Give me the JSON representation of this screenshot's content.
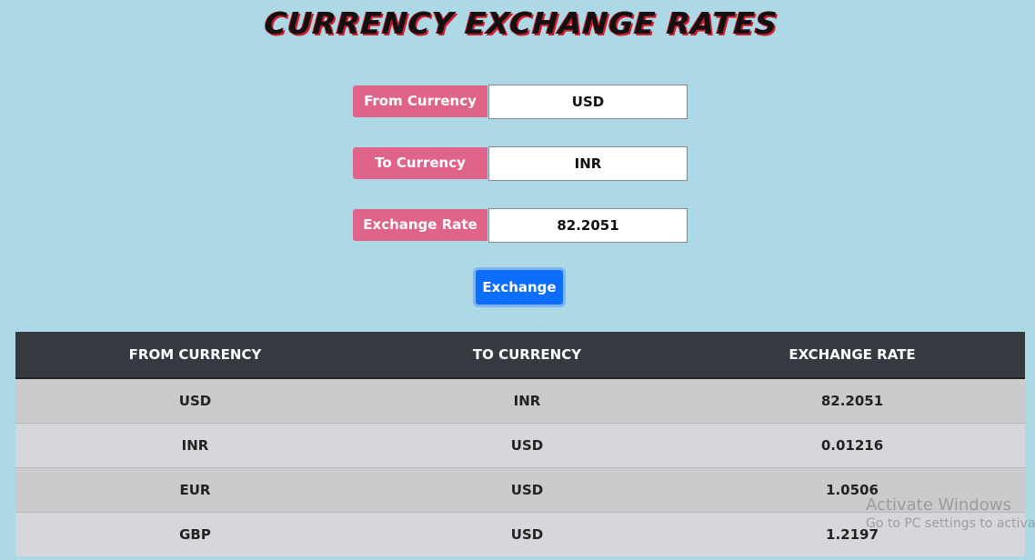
{
  "header": {
    "title": "CURRENCY EXCHANGE RATES"
  },
  "form": {
    "from": {
      "label": "From Currency",
      "value": "USD"
    },
    "to": {
      "label": "To Currency",
      "value": "INR"
    },
    "rate": {
      "label": "Exchange Rate",
      "value": "82.2051"
    },
    "submit_label": "Exchange"
  },
  "table": {
    "headers": [
      "FROM CURRENCY",
      "TO CURRENCY",
      "EXCHANGE RATE"
    ],
    "rows": [
      [
        "USD",
        "INR",
        "82.2051"
      ],
      [
        "INR",
        "USD",
        "0.01216"
      ],
      [
        "EUR",
        "USD",
        "1.0506"
      ],
      [
        "GBP",
        "USD",
        "1.2197"
      ]
    ]
  },
  "watermark": {
    "title": "Activate Windows",
    "subtitle": "Go to PC settings to activate"
  },
  "colors": {
    "background": "#add8e6",
    "label_bg": "#e0648a",
    "button_bg": "#0d6efd",
    "table_header_bg": "#343a40",
    "title_shadow": "#d11a2a"
  }
}
